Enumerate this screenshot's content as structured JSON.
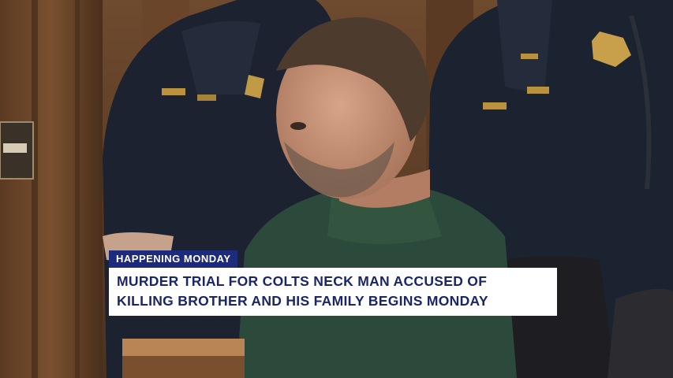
{
  "lower_third": {
    "tag": "HAPPENING MONDAY",
    "headline_line1": "MURDER TRIAL FOR COLTS NECK MAN ACCUSED OF",
    "headline_line2": "KILLING BROTHER AND HIS FAMILY BEGINS MONDAY"
  },
  "colors": {
    "tag_background": "#1c2b7c",
    "headline_background": "#ffffff",
    "headline_text": "#1a2668"
  }
}
